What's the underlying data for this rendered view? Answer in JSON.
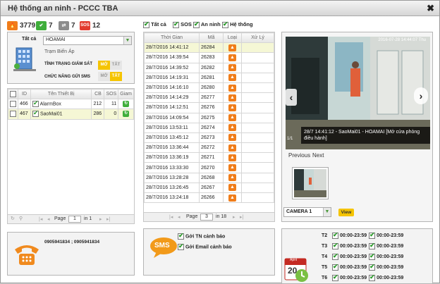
{
  "window": {
    "title": "Hệ thống an ninh - PCCC TBA",
    "close": "✖"
  },
  "stats": [
    {
      "icon": "fire-alarm-icon",
      "value": "3779",
      "glyph": "🔥",
      "color": "orange"
    },
    {
      "icon": "check-icon",
      "value": "7",
      "glyph": "✔",
      "color": "green"
    },
    {
      "icon": "refresh-icon",
      "value": "7",
      "glyph": "⇄",
      "color": "gray"
    },
    {
      "icon": "sos-icon",
      "value": "12",
      "glyph": "SOS",
      "color": "red"
    }
  ],
  "station": {
    "filter_label": "Tất cả",
    "selected": "HOAMAI",
    "sub_label": "Trạm Biến Áp",
    "monitor_label": "TÌNH TRẠNG GIÁM SÁT",
    "sms_label": "CHỨC NĂNG GỬI SMS",
    "on": "MỞ",
    "off": "TẮT"
  },
  "devices": {
    "headers": [
      "ID",
      "Tên Thiết Bị",
      "CB",
      "SOS",
      "Giam"
    ],
    "rows": [
      {
        "id": "466",
        "name": "AlarmBox",
        "cb": "212",
        "sos": "11"
      },
      {
        "id": "467",
        "name": "SaoMai01",
        "cb": "286",
        "sos": "0"
      }
    ],
    "pager": {
      "page_label": "Page",
      "page": "1",
      "of": "in 1"
    }
  },
  "phone": {
    "numbers": "0905941834 ; 0905941834"
  },
  "filters": [
    {
      "label": "Tất cả",
      "checked": true
    },
    {
      "label": "SOS",
      "checked": true
    },
    {
      "label": "An ninh",
      "checked": true
    },
    {
      "label": "Hệ thống",
      "checked": true
    }
  ],
  "events": {
    "headers": [
      "Thời Gian",
      "Mã",
      "Loại",
      "Xử Lý"
    ],
    "rows": [
      {
        "time": "28/7/2016 14:41:12",
        "code": "26284"
      },
      {
        "time": "28/7/2016 14:39:54",
        "code": "26283"
      },
      {
        "time": "28/7/2016 14:39:52",
        "code": "26282"
      },
      {
        "time": "28/7/2016 14:19:31",
        "code": "26281"
      },
      {
        "time": "28/7/2016 14:16:10",
        "code": "26280"
      },
      {
        "time": "28/7/2016 14:14:29",
        "code": "26277"
      },
      {
        "time": "28/7/2016 14:12:51",
        "code": "26276"
      },
      {
        "time": "28/7/2016 14:09:54",
        "code": "26275"
      },
      {
        "time": "28/7/2016 13:53:11",
        "code": "26274"
      },
      {
        "time": "28/7/2016 13:45:12",
        "code": "26273"
      },
      {
        "time": "28/7/2016 13:36:44",
        "code": "26272"
      },
      {
        "time": "28/7/2016 13:36:19",
        "code": "26271"
      },
      {
        "time": "28/7/2016 13:33:30",
        "code": "26270"
      },
      {
        "time": "28/7/2016 13:28:28",
        "code": "26268"
      },
      {
        "time": "28/7/2016 13:26:45",
        "code": "26267"
      },
      {
        "time": "28/7/2016 13:24:18",
        "code": "26266"
      }
    ],
    "pager": {
      "page_label": "Page",
      "page": "3",
      "of": "in 18"
    }
  },
  "notify": {
    "sms_badge": "SMS",
    "sms_label": "Gởi TN cảnh báo",
    "email_label": "Gởi Email cảnh báo"
  },
  "camera": {
    "timestamp": "2016-07-28 14:44:07 Thu",
    "caption": "28/7 14:41:12 - SaoMai01 - HOAMAI [Mở cửa phòng điều hành]",
    "counter": "1/1",
    "previous": "Previous",
    "next": "Next",
    "select": "CAMERA 1",
    "view": "View"
  },
  "schedule": {
    "calendar_month": "April",
    "calendar_day": "20",
    "rows": [
      {
        "day": "T2",
        "a": "00:00-23:59",
        "b": "00:00-23:59"
      },
      {
        "day": "T3",
        "a": "00:00-23:59",
        "b": "00:00-23:59"
      },
      {
        "day": "T4",
        "a": "00:00-23:59",
        "b": "00:00-23:59"
      },
      {
        "day": "T5",
        "a": "00:00-23:59",
        "b": "00:00-23:59"
      },
      {
        "day": "T6",
        "a": "00:00-23:59",
        "b": "00:00-23:59"
      }
    ]
  }
}
